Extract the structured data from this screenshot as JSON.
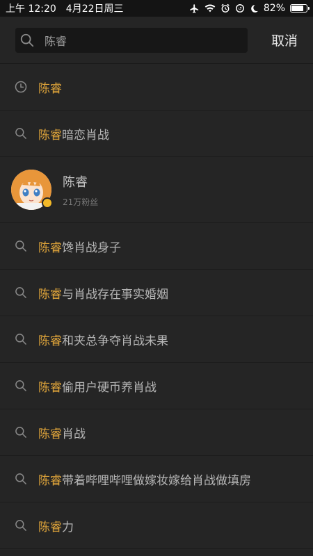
{
  "status_bar": {
    "time": "上午 12:20",
    "date": "4月22日周三",
    "battery": "82%",
    "battery_level": 0.82,
    "icons": [
      "airplane-icon",
      "wifi-icon",
      "alarm-icon",
      "sync-icon",
      "moon-icon",
      "battery-icon"
    ]
  },
  "search": {
    "query": "陈睿",
    "cancel_label": "取消"
  },
  "colors": {
    "highlight": "#e0a53a",
    "background": "#252525",
    "text": "#b7b7b7"
  },
  "history": {
    "icon": "clock-icon",
    "keyword": "陈睿"
  },
  "suggestion_top": {
    "icon": "search-icon",
    "keyword": "陈睿",
    "rest": "暗恋肖战"
  },
  "user": {
    "name": "陈睿",
    "fans": "21万粉丝",
    "badge": "verified-icon"
  },
  "suggestions": [
    {
      "keyword": "陈睿",
      "rest": "馋肖战身子"
    },
    {
      "keyword": "陈睿",
      "rest": "与肖战存在事实婚姻"
    },
    {
      "keyword": "陈睿",
      "rest": "和夹总争夺肖战未果"
    },
    {
      "keyword": "陈睿",
      "rest": "偷用户硬币养肖战"
    },
    {
      "keyword": "陈睿",
      "rest": "肖战"
    },
    {
      "keyword": "陈睿",
      "rest": "带着哔哩哔哩做嫁妆嫁给肖战做填房"
    },
    {
      "keyword": "陈睿",
      "rest": "力"
    }
  ]
}
